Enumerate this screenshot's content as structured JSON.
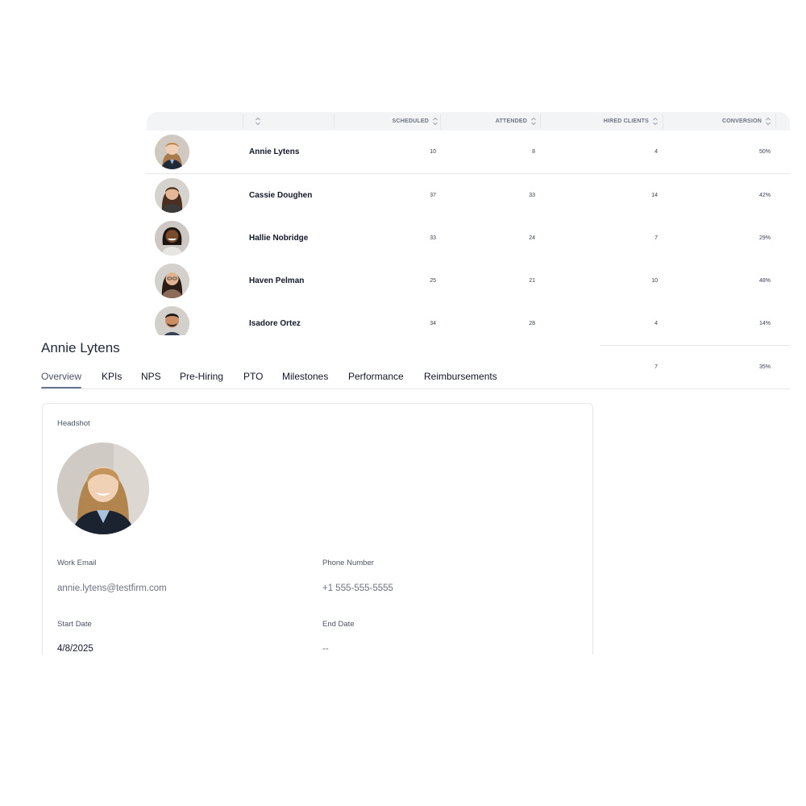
{
  "table": {
    "columns": [
      {
        "label": ""
      },
      {
        "label": "SCHEDULED"
      },
      {
        "label": "ATTENDED"
      },
      {
        "label": "HIRED CLIENTS"
      },
      {
        "label": "CONVERSION"
      }
    ],
    "rows": [
      {
        "name": "Annie Lytens",
        "scheduled": "10",
        "attended": "8",
        "hired": "4",
        "conversion": "50%"
      },
      {
        "name": "Cassie Doughen",
        "scheduled": "37",
        "attended": "33",
        "hired": "14",
        "conversion": "42%"
      },
      {
        "name": "Hallie Nobridge",
        "scheduled": "33",
        "attended": "24",
        "hired": "7",
        "conversion": "29%"
      },
      {
        "name": "Haven Pelman",
        "scheduled": "25",
        "attended": "21",
        "hired": "10",
        "conversion": "48%"
      },
      {
        "name": "Isadore Ortez",
        "scheduled": "34",
        "attended": "28",
        "hired": "4",
        "conversion": "14%"
      },
      {
        "name": "",
        "scheduled": "",
        "attended": "",
        "hired": "7",
        "conversion": "35%"
      }
    ]
  },
  "profile": {
    "title": "Annie Lytens",
    "tabs": [
      {
        "label": "Overview"
      },
      {
        "label": "KPIs"
      },
      {
        "label": "NPS"
      },
      {
        "label": "Pre-Hiring"
      },
      {
        "label": "PTO"
      },
      {
        "label": "Milestones"
      },
      {
        "label": "Performance"
      },
      {
        "label": "Reimbursements"
      }
    ],
    "active_tab": "Overview",
    "headshot_label": "Headshot",
    "work_email_label": "Work Email",
    "work_email": "annie.lytens@testfirm.com",
    "phone_label": "Phone Number",
    "phone": "+1 555-555-5555",
    "start_date_label": "Start Date",
    "start_date": "4/8/2025",
    "end_date_label": "End Date",
    "end_date": "--"
  },
  "colors": {
    "header_bg": "#f3f4f6",
    "border": "#e5e7eb",
    "active_tab_underline": "#64748b"
  },
  "icons": {
    "sort": "sort-arrows-icon"
  }
}
